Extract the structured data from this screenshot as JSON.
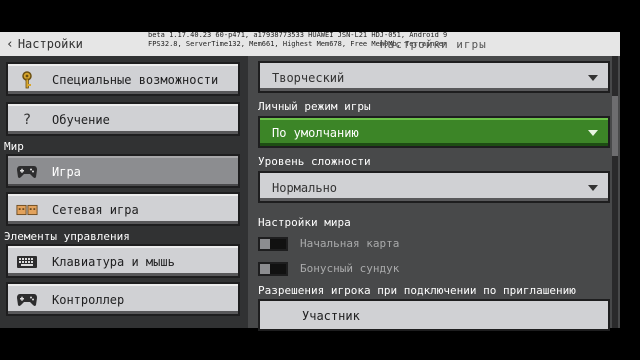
{
  "header": {
    "back_label": "Настройки",
    "debug_line1": "beta 1.17.40.23 60-p471, a17938773533 HUAWEI JSN-L21 HDJ-051, Android 9",
    "debug_line2": "FPS32.8, ServerTime132, Mem661, Highest Mem678, Free Mem0Mb, TerrainGen",
    "overlap_title": "Настройки игры"
  },
  "sidebar": {
    "items": [
      {
        "label": "Специальные возможности",
        "icon": "key-icon"
      },
      {
        "label": "Обучение",
        "icon": "question-icon"
      },
      {
        "label": "Игра",
        "icon": "gamepad-icon",
        "selected": true
      },
      {
        "label": "Сетевая игра",
        "icon": "multiplayer-icon"
      },
      {
        "label": "Клавиатура и мышь",
        "icon": "keyboard-icon"
      },
      {
        "label": "Контроллер",
        "icon": "controller-icon"
      }
    ],
    "section_world": "Мир",
    "section_controls": "Элементы управления"
  },
  "main": {
    "gamemode_value": "Творческий",
    "personal_mode_label": "Личный режим игры",
    "personal_mode_value": "По умолчанию",
    "difficulty_label": "Уровень сложности",
    "difficulty_value": "Нормально",
    "world_settings_label": "Настройки мира",
    "toggle_map_label": "Начальная карта",
    "toggle_chest_label": "Бонусный сундук",
    "permissions_label": "Разрешения игрока при подключении по приглашению",
    "permissions_value": "Участник"
  },
  "colors": {
    "accent_green": "#3c8527",
    "button_gray": "#d0d1d4",
    "panel_dark": "#313233",
    "panel_mid": "#48494a"
  }
}
